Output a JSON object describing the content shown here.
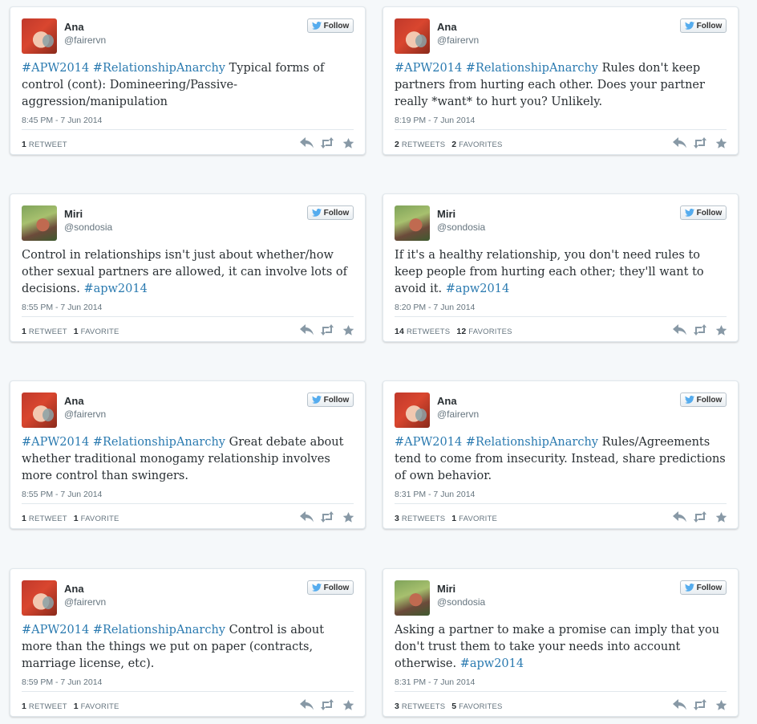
{
  "follow_label": "Follow",
  "tweets": [
    {
      "name": "Ana",
      "handle": "@fairervn",
      "avatar": "ana",
      "segments": [
        {
          "t": "#APW2014",
          "h": true
        },
        {
          "t": " ",
          "h": false
        },
        {
          "t": "#RelationshipAnarchy",
          "h": true
        },
        {
          "t": " Typical forms of control (cont): Domineering/Passive-aggression/manipulation",
          "h": false
        }
      ],
      "time": "8:45 PM - 7 Jun 2014",
      "retweets": "1",
      "retweets_label": "RETWEET",
      "favorites": "",
      "favorites_label": ""
    },
    {
      "name": "Ana",
      "handle": "@fairervn",
      "avatar": "ana",
      "segments": [
        {
          "t": "#APW2014",
          "h": true
        },
        {
          "t": " ",
          "h": false
        },
        {
          "t": "#RelationshipAnarchy",
          "h": true
        },
        {
          "t": " Rules don't keep partners from hurting each other. Does your partner really *want* to hurt you? Unlikely.",
          "h": false
        }
      ],
      "time": "8:19 PM - 7 Jun 2014",
      "retweets": "2",
      "retweets_label": "RETWEETS",
      "favorites": "2",
      "favorites_label": "FAVORITES"
    },
    {
      "name": "Miri",
      "handle": "@sondosia",
      "avatar": "miri",
      "segments": [
        {
          "t": "Control in relationships isn't just about whether/how other sexual partners are allowed, it can involve lots of decisions. ",
          "h": false
        },
        {
          "t": "#apw2014",
          "h": true
        }
      ],
      "time": "8:55 PM - 7 Jun 2014",
      "retweets": "1",
      "retweets_label": "RETWEET",
      "favorites": "1",
      "favorites_label": "FAVORITE"
    },
    {
      "name": "Miri",
      "handle": "@sondosia",
      "avatar": "miri",
      "segments": [
        {
          "t": "If it's a healthy relationship, you don't need rules to keep people from hurting each other; they'll want to avoid it.  ",
          "h": false
        },
        {
          "t": "#apw2014",
          "h": true
        }
      ],
      "time": "8:20 PM - 7 Jun 2014",
      "retweets": "14",
      "retweets_label": "RETWEETS",
      "favorites": "12",
      "favorites_label": "FAVORITES"
    },
    {
      "name": "Ana",
      "handle": "@fairervn",
      "avatar": "ana",
      "segments": [
        {
          "t": "#APW2014",
          "h": true
        },
        {
          "t": " ",
          "h": false
        },
        {
          "t": "#RelationshipAnarchy",
          "h": true
        },
        {
          "t": " Great debate about whether traditional monogamy relationship involves more control than swingers.",
          "h": false
        }
      ],
      "time": "8:55 PM - 7 Jun 2014",
      "retweets": "1",
      "retweets_label": "RETWEET",
      "favorites": "1",
      "favorites_label": "FAVORITE"
    },
    {
      "name": "Ana",
      "handle": "@fairervn",
      "avatar": "ana",
      "segments": [
        {
          "t": "#APW2014",
          "h": true
        },
        {
          "t": " ",
          "h": false
        },
        {
          "t": "#RelationshipAnarchy",
          "h": true
        },
        {
          "t": " Rules/Agreements tend to come from insecurity. Instead, share predictions of own behavior.",
          "h": false
        }
      ],
      "time": "8:31 PM - 7 Jun 2014",
      "retweets": "3",
      "retweets_label": "RETWEETS",
      "favorites": "1",
      "favorites_label": "FAVORITE"
    },
    {
      "name": "Ana",
      "handle": "@fairervn",
      "avatar": "ana",
      "segments": [
        {
          "t": "#APW2014",
          "h": true
        },
        {
          "t": " ",
          "h": false
        },
        {
          "t": "#RelationshipAnarchy",
          "h": true
        },
        {
          "t": " Control is about more than the things we put on paper (contracts, marriage license, etc).",
          "h": false
        }
      ],
      "time": "8:59 PM - 7 Jun 2014",
      "retweets": "1",
      "retweets_label": "RETWEET",
      "favorites": "1",
      "favorites_label": "FAVORITE"
    },
    {
      "name": "Miri",
      "handle": "@sondosia",
      "avatar": "miri",
      "segments": [
        {
          "t": "Asking a partner to make a promise can imply that you don't trust them to take your needs into account otherwise. ",
          "h": false
        },
        {
          "t": "#apw2014",
          "h": true
        }
      ],
      "time": "8:31 PM - 7 Jun 2014",
      "retweets": "3",
      "retweets_label": "RETWEETS",
      "favorites": "5",
      "favorites_label": "FAVORITES"
    }
  ]
}
